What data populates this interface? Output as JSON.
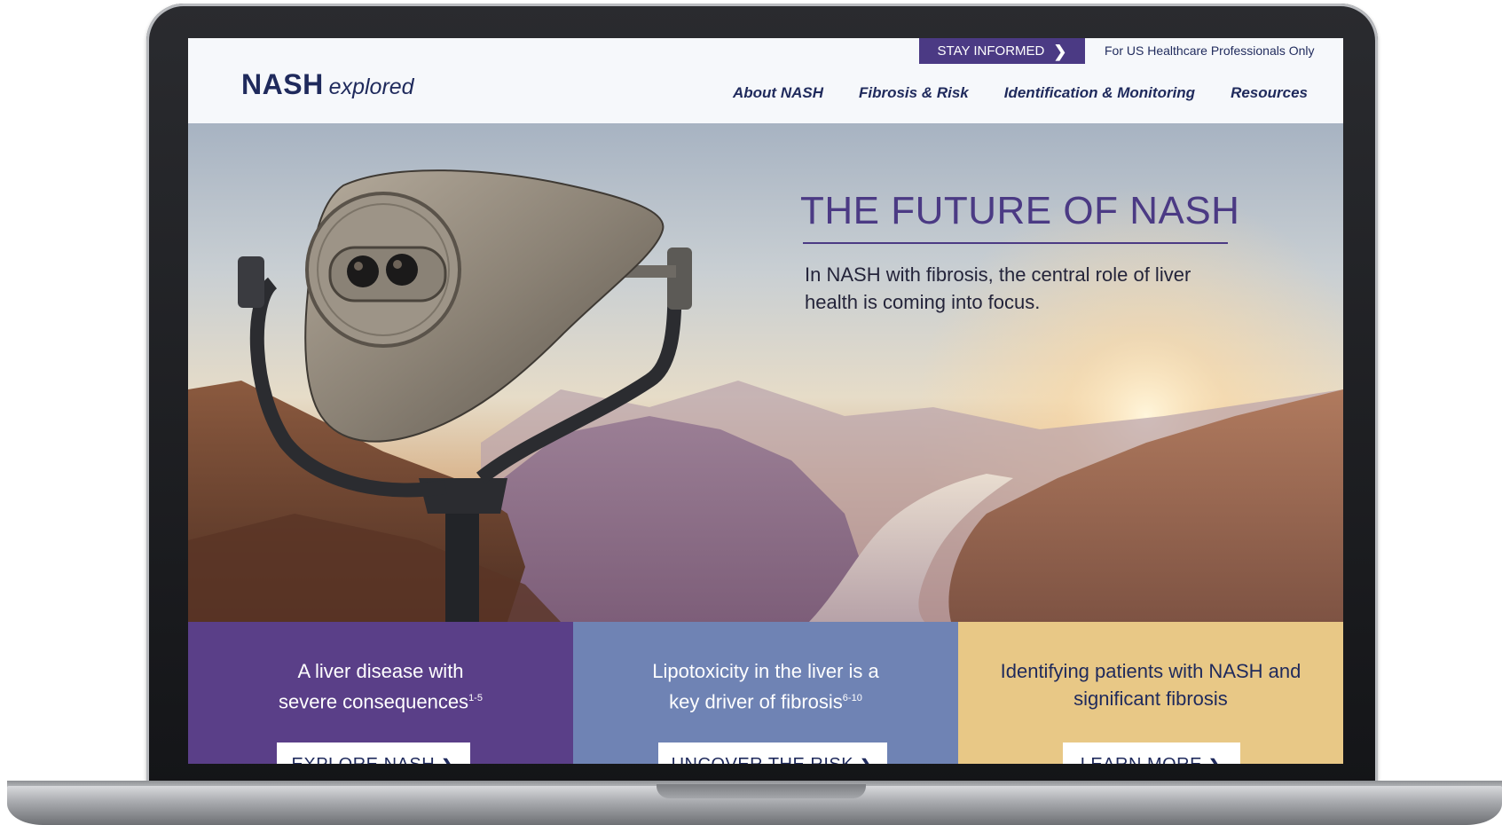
{
  "header": {
    "logo_bold": "NASH",
    "logo_italic": "explored",
    "stay_informed": "STAY INFORMED",
    "hcp_note": "For US Healthcare Professionals Only",
    "nav": [
      {
        "label": "About NASH"
      },
      {
        "label": "Fibrosis & Risk"
      },
      {
        "label": "Identification & Monitoring"
      },
      {
        "label": "Resources"
      }
    ]
  },
  "hero": {
    "title": "THE FUTURE OF NASH",
    "subtitle": "In NASH with fibrosis, the central role of liver health is coming into focus."
  },
  "cards": [
    {
      "text": "A liver disease with severe consequences",
      "sup": "1-5",
      "button": "EXPLORE NASH",
      "color": "#5a3f88"
    },
    {
      "text": "Lipotoxicity in the liver is a key driver of fibrosis",
      "sup": "6-10",
      "button": "UNCOVER THE RISK",
      "color": "#6f83b4"
    },
    {
      "text": "Identifying patients with NASH and significant fibrosis",
      "sup": "",
      "button": "LEARN MORE",
      "color": "#e8c886"
    }
  ],
  "colors": {
    "brand_navy": "#1f2a5c",
    "brand_purple": "#4b3a84"
  },
  "icons": {
    "chevron": "chevron-right-icon",
    "hero_image": "liver-binocular-image"
  }
}
